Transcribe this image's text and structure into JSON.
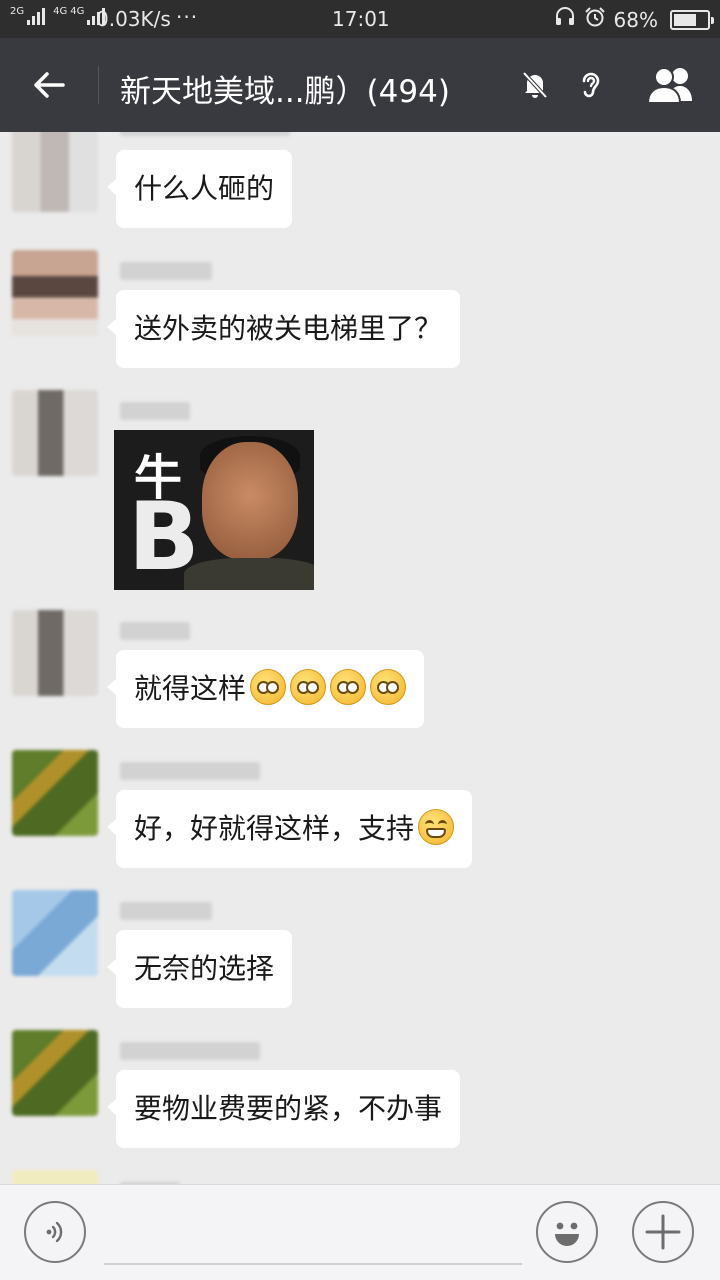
{
  "status_bar": {
    "network_1": "2G",
    "network_2": "4G",
    "network_3": "4G",
    "speed": "0.03K/s",
    "more": "···",
    "time": "17:01",
    "battery_percent": "68%",
    "battery_level": 0.68,
    "icons": [
      "headset-icon",
      "alarm-icon",
      "battery-icon"
    ]
  },
  "header": {
    "title": "新天地美域...鹏）(494)",
    "icons": [
      "back-arrow-icon",
      "mute-bell-icon",
      "ear-icon",
      "group-members-icon"
    ]
  },
  "messages": [
    {
      "type": "text",
      "text": "什么人砸的"
    },
    {
      "type": "text",
      "text": "送外卖的被关电梯里了？"
    },
    {
      "type": "sticker",
      "caption_top": "牛",
      "caption_bottom": "B"
    },
    {
      "type": "text",
      "text": "就得这样",
      "emojis": [
        "emoji-wink-thumb",
        "emoji-wink-thumb",
        "emoji-wink-thumb",
        "emoji-wink-thumb"
      ]
    },
    {
      "type": "text",
      "text": "好，好就得这样，支持",
      "emojis": [
        "emoji-grin"
      ]
    },
    {
      "type": "text",
      "text": "无奈的选择"
    },
    {
      "type": "text",
      "text": "要物业费要的紧，不办事"
    }
  ],
  "colors": {
    "header_bg": "#393a3f",
    "status_bg": "#2e2e2e",
    "chat_bg": "#ebebeb",
    "bubble_bg": "#ffffff"
  },
  "input_bar": {
    "icons": [
      "voice-icon",
      "emoji-icon",
      "plus-icon"
    ]
  }
}
